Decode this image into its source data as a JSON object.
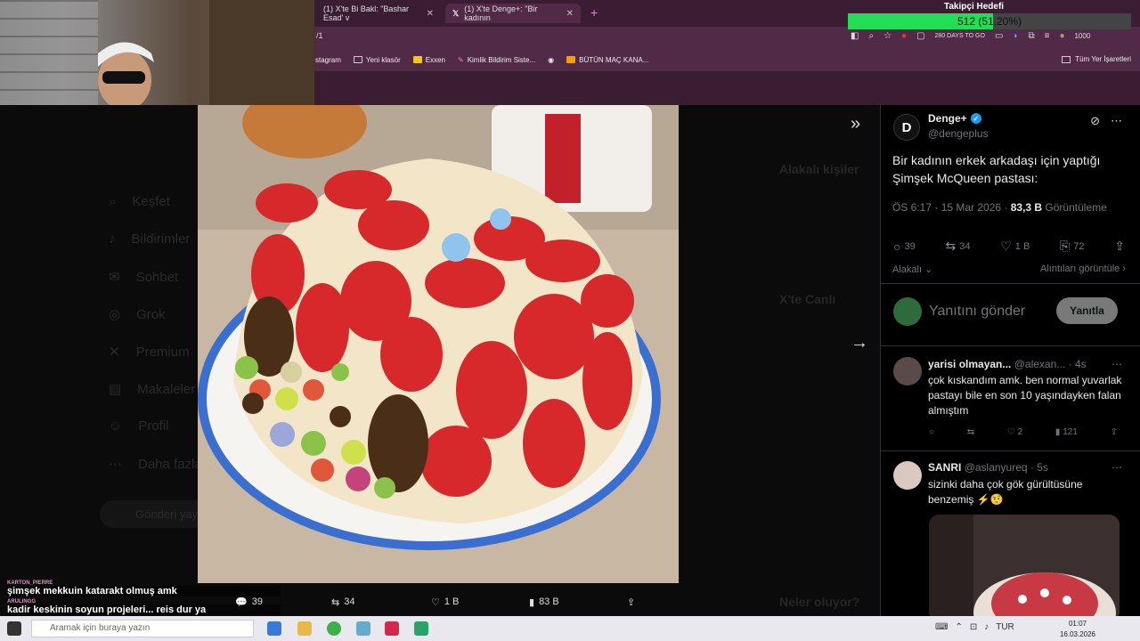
{
  "browser": {
    "tabs": [
      {
        "label": "(1) X'te Bi Bakl: \"Bashar Esad' v"
      },
      {
        "label": "(1) X'te Denge+: \"Bir kadının"
      }
    ],
    "address": "/1",
    "bookmarks": [
      "stagram",
      "Yeni klasör",
      "Exxen",
      "Kimlik Bildirim Siste...",
      "BÜTÜN MAÇ KANA..."
    ],
    "all_bookmarks": "Tüm Yer İşaretleri",
    "toolbar_extra": "280 DAYS TO GO",
    "toolbar_num": "1000"
  },
  "follower_goal": {
    "title": "Takipçi Hedefi",
    "text": "512 (51.20%)",
    "fraction": 0.512
  },
  "background_nav": [
    "Keşfet",
    "Bildirimler",
    "Sohbet",
    "Grok",
    "Premium",
    "Makaleler",
    "Profil",
    "Daha fazla"
  ],
  "background_right": {
    "heading1": "Alakalı kişiler",
    "heading2": "X'te Canlı",
    "heading3": "Neler oluyor?",
    "post_button": "Gönderi yayınla"
  },
  "media_actions": {
    "replies": "39",
    "retweets": "34",
    "likes": "1 B",
    "views": "83 B"
  },
  "chat": [
    {
      "user": "KARTON_PIERRE",
      "msg": "şimşek mekkuin katarakt olmuş amk"
    },
    {
      "user": "ARULINGG",
      "msg": "kadir keskinin soyun projeleri... reis dur ya"
    }
  ],
  "post": {
    "author": "Denge+",
    "handle": "@dengeplus",
    "text": "Bir kadının erkek arkadaşı için yaptığı Şimşek McQueen pastası:",
    "time": "ÖS 6:17 · 15 Mar 2026 · ",
    "views_count": "83,3 B",
    "views_label": " Görüntüleme",
    "replies": "39",
    "retweets": "34",
    "likes": "1 B",
    "bookmarks": "72",
    "relevance": "Alakalı",
    "quotes": "Alıntıları görüntüle",
    "reply_placeholder": "Yanıtını gönder",
    "reply_button": "Yanıtla"
  },
  "replies": [
    {
      "name": "yarisi olmayan...",
      "handle": "@alexan... · 4s",
      "text": "çok kıskandım amk. ben normal yuvarlak pastayı bile en son 10 yaşındayken falan almıştım",
      "likes": "2",
      "views": "121"
    },
    {
      "name": "SANRI",
      "handle": "@aslanyureq · 5s",
      "text": "sizinki daha çok gök gürültüsüne benzemiş ⚡🤨"
    }
  ],
  "taskbar": {
    "search": "Aramak için buraya yazın",
    "lang": "TUR",
    "time": "01:07",
    "date": "16.03.2026"
  }
}
